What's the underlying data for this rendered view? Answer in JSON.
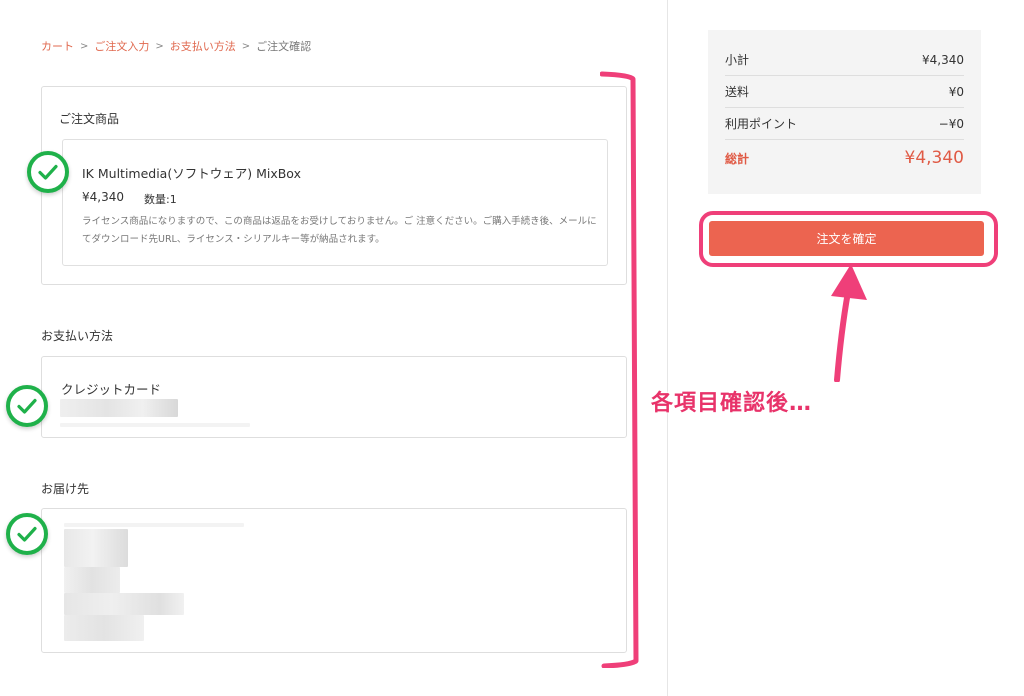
{
  "breadcrumb": {
    "items": [
      "カート",
      "ご注文入力",
      "お支払い方法"
    ],
    "current": "ご注文確認",
    "separator": ">"
  },
  "order_items": {
    "title": "ご注文商品",
    "product": {
      "name": "IK Multimedia(ソフトウェア) MixBox",
      "price": "¥4,340",
      "quantity": "数量:1",
      "note": "ライセンス商品になりますので、この商品は返品をお受けしておりません。ご 注意ください。ご購入手続き後、メールにてダウンロード先URL、ライセンス・シリアルキー等が納品されます。"
    }
  },
  "payment": {
    "title": "お支払い方法",
    "method": "クレジットカード"
  },
  "shipping": {
    "title": "お届け先"
  },
  "summary": {
    "subtotal_label": "小計",
    "subtotal_value": "¥4,340",
    "shipping_label": "送料",
    "shipping_value": "¥0",
    "points_label": "利用ポイント",
    "points_value": "−¥0",
    "total_label": "総計",
    "total_value": "¥4,340"
  },
  "confirm_button": "注文を確定",
  "annotation": "各項目確認後…",
  "colors": {
    "accent": "#ec6450",
    "annotation_pink": "#ef3f79",
    "check_green": "#1fb14a",
    "link": "#e0694f"
  },
  "icons": [
    "check-circle-icon",
    "chevron-right-icon",
    "arrow-up-icon"
  ]
}
